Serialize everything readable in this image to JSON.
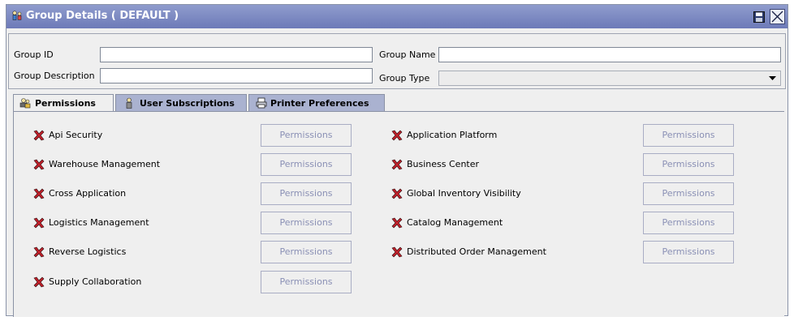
{
  "window": {
    "title": "Group Details ( DEFAULT )"
  },
  "form": {
    "group_id": {
      "label": "Group ID",
      "value": ""
    },
    "group_name": {
      "label": "Group Name",
      "value": ""
    },
    "group_description": {
      "label": "Group Description",
      "value": ""
    },
    "group_type": {
      "label": "Group Type",
      "value": ""
    }
  },
  "tabs": [
    {
      "label": "Permissions",
      "icon": "users-icon",
      "active": true
    },
    {
      "label": "User Subscriptions",
      "icon": "user-icon",
      "active": false
    },
    {
      "label": "Printer Preferences",
      "icon": "printer-icon",
      "active": false
    }
  ],
  "permissions": {
    "button_label": "Permissions",
    "left": [
      "Api Security",
      "Warehouse Management",
      "Cross Application",
      "Logistics Management",
      "Reverse Logistics",
      "Supply Collaboration"
    ],
    "right": [
      "Application Platform",
      "Business Center",
      "Global Inventory Visibility",
      "Catalog Management",
      "Distributed Order Management"
    ]
  },
  "colors": {
    "title_bar": "#7b88c2",
    "denied_mark": "#c0202a",
    "tab_inactive": "#aab2d0"
  }
}
